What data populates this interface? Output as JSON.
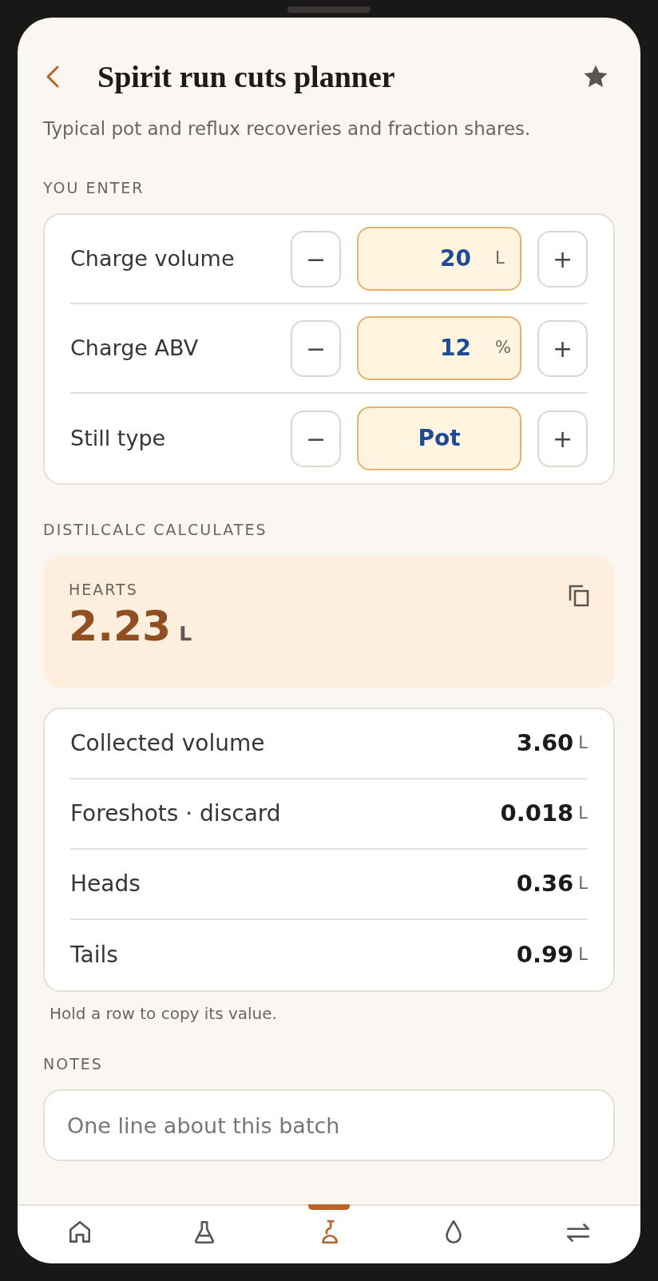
{
  "header": {
    "title": "Spirit run cuts planner",
    "favorite": true
  },
  "subtitle": "Typical pot and reflux recoveries and fraction shares.",
  "inputs_heading": "YOU ENTER",
  "inputs": [
    {
      "label": "Charge volume",
      "value": "20",
      "unit": "L",
      "decrement": "−",
      "increment": "+"
    },
    {
      "label": "Charge ABV",
      "value": "12",
      "unit": "%",
      "decrement": "−",
      "increment": "+"
    },
    {
      "label": "Still type",
      "value": "Pot",
      "decrement": "−",
      "increment": "+"
    }
  ],
  "results_heading": "DISTILCALC CALCULATES",
  "hero": {
    "label": "HEARTS",
    "value": "2.23",
    "unit": "L"
  },
  "results": [
    {
      "label": "Collected volume",
      "value": "3.60",
      "unit": "L"
    },
    {
      "label": "Foreshots · discard",
      "value": "0.018",
      "unit": "L"
    },
    {
      "label": "Heads",
      "value": "0.36",
      "unit": "L"
    },
    {
      "label": "Tails",
      "value": "0.99",
      "unit": "L"
    }
  ],
  "hint": "Hold a row to copy its value.",
  "notes_heading": "NOTES",
  "notes": {
    "placeholder": "One line about this batch"
  },
  "nav": [
    {
      "kind": "home",
      "selected": false
    },
    {
      "kind": "flask",
      "selected": false
    },
    {
      "kind": "still",
      "selected": true
    },
    {
      "kind": "drop",
      "selected": false
    },
    {
      "kind": "swap",
      "selected": false
    }
  ]
}
